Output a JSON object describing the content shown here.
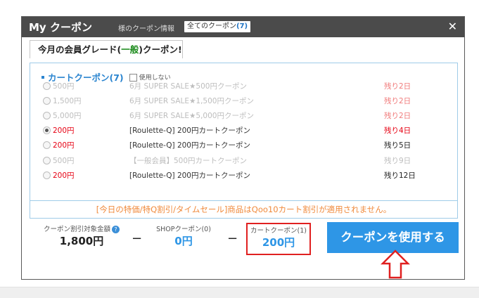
{
  "dialog": {
    "title_prefix": "My",
    "title_rest": " クーポン",
    "tab_grade": "様のクーポン情報",
    "tab_all": "全てのクーポン",
    "tab_all_count": "(7)",
    "close_icon": "close-icon"
  },
  "grade": {
    "prefix": "今月の会員グレード(",
    "level": "一般",
    "suffix": ")クーポン!"
  },
  "cart_coupons": {
    "title": "カートクーポン(7)",
    "no_use_label": "使用しない",
    "rows": [
      {
        "amount": "500円",
        "name": "6月 SUPER SALE★500円クーポン",
        "remaining": "残り2日",
        "enabled": false,
        "selected": false
      },
      {
        "amount": "1,500円",
        "name": "6月 SUPER SALE★1,500円クーポン",
        "remaining": "残り2日",
        "enabled": false,
        "selected": false
      },
      {
        "amount": "5,000円",
        "name": "6月 SUPER SALE★5,000円クーポン",
        "remaining": "残り2日",
        "enabled": false,
        "selected": false
      },
      {
        "amount": "200円",
        "name": "[Roulette-Q] 200円カートクーポン",
        "remaining": "残り4日",
        "enabled": true,
        "selected": true
      },
      {
        "amount": "200円",
        "name": "[Roulette-Q] 200円カートクーポン",
        "remaining": "残り5日",
        "enabled": true,
        "selected": false
      },
      {
        "amount": "500円",
        "name": "【一般会員】500円カートクーポン",
        "remaining": "残り9日",
        "enabled": false,
        "selected": false
      },
      {
        "amount": "200円",
        "name": "[Roulette-Q] 200円カートクーポン",
        "remaining": "残り12日",
        "enabled": true,
        "selected": false
      }
    ],
    "notice": "[今日の特価/特Q割引/タイムセール]商品はQoo10カート割引が適用されません。"
  },
  "summary": {
    "target_label": "クーポン割引対象金額",
    "help_icon": "?",
    "target_value": "1,800円",
    "minus": "−",
    "shop_label": "SHOPクーポン(0)",
    "shop_value": "0円",
    "cart_label": "カートクーポン(1)",
    "cart_value": "200円",
    "use_button": "クーポンを使用する"
  },
  "colors": {
    "accent_blue": "#2e96e6",
    "price_red": "#e60012",
    "highlight_red": "#e02020"
  }
}
